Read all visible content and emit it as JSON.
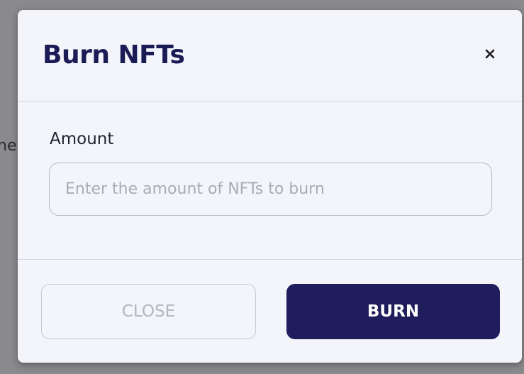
{
  "backdrop": {
    "partial_text": "ne"
  },
  "modal": {
    "title": "Burn NFTs",
    "close_icon": "close-icon",
    "amount": {
      "label": "Amount",
      "placeholder": "Enter the amount of NFTs to burn",
      "value": ""
    },
    "buttons": {
      "close_label": "CLOSE",
      "burn_label": "BURN"
    }
  },
  "colors": {
    "title": "#1b1b55",
    "primary_button": "#1f1d5c",
    "modal_background": "#f4f5fb",
    "disabled_text": "#b3b5bf"
  }
}
